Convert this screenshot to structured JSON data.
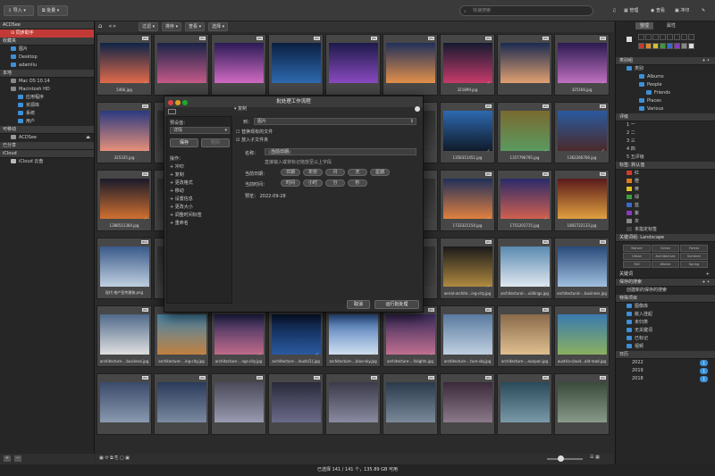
{
  "colors": {
    "accent": "#c23a36",
    "folder": "#3d8fd6"
  },
  "topbar": {
    "import": "导入",
    "batch": "批量",
    "search_placeholder": "快速搜索",
    "modes": [
      "管理",
      "查看",
      "冲印"
    ],
    "edit_icon": "✎"
  },
  "sidebar": {
    "sections": [
      {
        "header": "ACDSee",
        "items": [
          {
            "label": "同步助手",
            "selected": true
          }
        ]
      },
      {
        "header": "收藏夹",
        "items": [
          {
            "label": "图片"
          },
          {
            "label": "Desktop"
          },
          {
            "label": "adamliu"
          }
        ]
      },
      {
        "header": "本地",
        "items": [
          {
            "label": "Mac OS 10.14"
          },
          {
            "label": "Macintosh HD"
          },
          {
            "label": "应用程序"
          },
          {
            "label": "资源库"
          },
          {
            "label": "系统"
          },
          {
            "label": "用户"
          }
        ]
      },
      {
        "header": "可移动",
        "items": [
          {
            "label": "ACDSee"
          }
        ]
      },
      {
        "header": "已分享",
        "items": []
      },
      {
        "header": "iCloud",
        "items": [
          {
            "label": "iCloud 云盘"
          }
        ]
      }
    ]
  },
  "toolbar": {
    "filter": "过滤",
    "sort": "排序",
    "view": "查看",
    "select": "选择"
  },
  "grid": {
    "items": [
      {
        "name": "5466.jpg",
        "fmt": "JPG",
        "c": [
          "#0e2447",
          "#e26a4a"
        ]
      },
      {
        "name": "",
        "fmt": "JPG",
        "c": [
          "#1a2346",
          "#c55a8a"
        ]
      },
      {
        "name": "",
        "fmt": "JPG",
        "c": [
          "#2a1b55",
          "#d16ac4"
        ]
      },
      {
        "name": "",
        "fmt": "JPG",
        "c": [
          "#0a1f40",
          "#2f6ab0"
        ]
      },
      {
        "name": "",
        "fmt": "JPG",
        "c": [
          "#1d1a4a",
          "#8a4ac0"
        ]
      },
      {
        "name": "",
        "fmt": "JPG",
        "c": [
          "#20305a",
          "#e2904a"
        ]
      },
      {
        "name": "321899.jpg",
        "fmt": "JPG",
        "c": [
          "#141a30",
          "#c63a6a"
        ]
      },
      {
        "name": "",
        "fmt": "JPG",
        "c": [
          "#1a2a50",
          "#e0a070"
        ]
      },
      {
        "name": "325166.jpg",
        "fmt": "JPG",
        "c": [
          "#2a1a50",
          "#c070c0"
        ]
      },
      {
        "name": "325335.jpg",
        "fmt": "JPG",
        "c": [
          "#2a3a80",
          "#e6907a"
        ]
      },
      {
        "name": "",
        "fmt": "",
        "c": [
          "#333",
          "#444"
        ]
      },
      {
        "name": "",
        "fmt": "",
        "c": [
          "#333",
          "#444"
        ]
      },
      {
        "name": "",
        "fmt": "",
        "c": [
          "#333",
          "#444"
        ]
      },
      {
        "name": "",
        "fmt": "",
        "c": [
          "#333",
          "#444"
        ]
      },
      {
        "name": "",
        "fmt": "",
        "c": [
          "#333",
          "#444"
        ]
      },
      {
        "name": "1358311451.jpg",
        "fmt": "JPG",
        "c": [
          "#2d6ab0",
          "#101a2a"
        ]
      },
      {
        "name": "1357796795.jpg",
        "fmt": "JPG",
        "c": [
          "#7a6a30",
          "#5a9a60"
        ]
      },
      {
        "name": "1362266766.jpg",
        "fmt": "JPG",
        "c": [
          "#2a5aa0",
          "#4a2a2a"
        ]
      },
      {
        "name": "1388511364.jpg",
        "fmt": "JPG",
        "c": [
          "#1a1a2a",
          "#d07030"
        ]
      },
      {
        "name": "",
        "fmt": "",
        "c": [
          "#333",
          "#444"
        ]
      },
      {
        "name": "",
        "fmt": "",
        "c": [
          "#333",
          "#444"
        ]
      },
      {
        "name": "",
        "fmt": "",
        "c": [
          "#333",
          "#444"
        ]
      },
      {
        "name": "",
        "fmt": "",
        "c": [
          "#333",
          "#444"
        ]
      },
      {
        "name": "",
        "fmt": "",
        "c": [
          "#333",
          "#444"
        ]
      },
      {
        "name": "1733321154.jpg",
        "fmt": "JPG",
        "c": [
          "#20305a",
          "#e08040"
        ]
      },
      {
        "name": "1751201715.jpg",
        "fmt": "JPG",
        "c": [
          "#2a2a6a",
          "#d06050"
        ]
      },
      {
        "name": "1802722133.jpg",
        "fmt": "JPG",
        "c": [
          "#5a1a1a",
          "#e0a040"
        ]
      },
      {
        "name": "现代·地产宣传建筑.png",
        "fmt": "PNG",
        "c": [
          "#3a5a8a",
          "#c0d0e0"
        ]
      },
      {
        "name": "",
        "fmt": "",
        "c": [
          "#333",
          "#444"
        ]
      },
      {
        "name": "",
        "fmt": "",
        "c": [
          "#333",
          "#444"
        ]
      },
      {
        "name": "",
        "fmt": "",
        "c": [
          "#333",
          "#444"
        ]
      },
      {
        "name": "",
        "fmt": "",
        "c": [
          "#333",
          "#444"
        ]
      },
      {
        "name": "",
        "fmt": "",
        "c": [
          "#333",
          "#444"
        ]
      },
      {
        "name": "aerial-archite…ing-city.jpg",
        "fmt": "JPG",
        "c": [
          "#1a1a1a",
          "#b08a40"
        ]
      },
      {
        "name": "architectural-…uildings.jpg",
        "fmt": "JPG",
        "c": [
          "#5a8ab0",
          "#e0e8f0"
        ]
      },
      {
        "name": "architectural-…business.jpg",
        "fmt": "JPG",
        "c": [
          "#2a4a7a",
          "#a0c0e0"
        ]
      },
      {
        "name": "architecture-…business.jpg",
        "fmt": "JPG",
        "c": [
          "#506a8a",
          "#e0e0e0"
        ]
      },
      {
        "name": "architecture-…ing-city.jpg",
        "fmt": "JPG",
        "c": [
          "#4a8ab0",
          "#c08040"
        ]
      },
      {
        "name": "architecture-…ngs-city.jpg",
        "fmt": "JPG",
        "c": [
          "#2a2a5a",
          "#c06a8a"
        ]
      },
      {
        "name": "architecture-…louds(1).jpg",
        "fmt": "JPG",
        "c": [
          "#0a1a3a",
          "#2a5aa0"
        ]
      },
      {
        "name": "architecture-…blue-sky.jpg",
        "fmt": "JPG",
        "c": [
          "#3a6ab0",
          "#d0e0f0"
        ]
      },
      {
        "name": "architecture-…falights.jpg",
        "fmt": "JPG",
        "c": [
          "#3a2a5a",
          "#c07090"
        ]
      },
      {
        "name": "architecture-…ture-sky.jpg",
        "fmt": "JPG",
        "c": [
          "#5a7aa0",
          "#c0d0e0"
        ]
      },
      {
        "name": "architecture-…eunpan.jpg",
        "fmt": "JPG",
        "c": [
          "#8a6a4a",
          "#e0c090"
        ]
      },
      {
        "name": "austria-cloud…ald-road.jpg",
        "fmt": "JPG",
        "c": [
          "#3a7ab0",
          "#8ab060"
        ]
      },
      {
        "name": "",
        "fmt": "JPG",
        "c": [
          "#3a4a6a",
          "#8a9ab0"
        ]
      },
      {
        "name": "",
        "fmt": "JPG",
        "c": [
          "#2a3a5a",
          "#7a8aa0"
        ]
      },
      {
        "name": "",
        "fmt": "JPG",
        "c": [
          "#4a4a5a",
          "#9a9ab0"
        ]
      },
      {
        "name": "",
        "fmt": "JPG",
        "c": [
          "#2a2a3a",
          "#6a6a8a"
        ]
      },
      {
        "name": "",
        "fmt": "JPG",
        "c": [
          "#3a3a4a",
          "#8a8aa0"
        ]
      },
      {
        "name": "",
        "fmt": "JPG",
        "c": [
          "#2a3a4a",
          "#7a8a9a"
        ]
      },
      {
        "name": "",
        "fmt": "JPG",
        "c": [
          "#3a2a3a",
          "#8a7a8a"
        ]
      },
      {
        "name": "",
        "fmt": "JPG",
        "c": [
          "#2a4a5a",
          "#7a9aaa"
        ]
      },
      {
        "name": "",
        "fmt": "JPG",
        "c": [
          "#3a4a3a",
          "#8a9a8a"
        ]
      }
    ]
  },
  "status": "已选择 141 / 141 个，135.89 GB 可用",
  "right": {
    "tabs": [
      "整理",
      "属性"
    ],
    "categories_header": "类别组",
    "categories": [
      "类别",
      "Albums",
      "People",
      "Friends",
      "Places",
      "Various"
    ],
    "rating_header": "评级",
    "ratings": [
      "一",
      "二",
      "三",
      "四",
      "五评级"
    ],
    "labels_header": "标签: 默认值",
    "labels": [
      {
        "t": "红",
        "c": "#d23a2a"
      },
      {
        "t": "橙",
        "c": "#e07a20"
      },
      {
        "t": "黄",
        "c": "#e0c020"
      },
      {
        "t": "绿",
        "c": "#3aa03a"
      },
      {
        "t": "蓝",
        "c": "#3a6ad0"
      },
      {
        "t": "紫",
        "c": "#8a3ac0"
      },
      {
        "t": "灰",
        "c": "#888888"
      },
      {
        "t": "未指定标签",
        "c": "#444444"
      }
    ],
    "keywords_header": "关键词组: Landscape",
    "keywords": [
      "Nature",
      "Ocean",
      "Forest",
      "Urban",
      "Architecture",
      "Summer",
      "Fall",
      "Winter",
      "Spring"
    ],
    "keyword_label": "关键词",
    "saved_header": "保存的搜索",
    "saved_item": "创建新的保存的搜索",
    "special_header": "特殊项目",
    "special": [
      "图像库",
      "嵌入挂起",
      "未归类",
      "无关键词",
      "已标记",
      "视频"
    ],
    "calendar_header": "日历",
    "years": [
      "2022",
      "2019",
      "2018"
    ]
  },
  "modal": {
    "title": "批处理工作流程",
    "preset_label": "预设值：",
    "preset_value": "详情",
    "save": "保存",
    "delete": "删除",
    "ops_label": "操作：",
    "ops": [
      "冲印",
      "复制",
      "更改格式",
      "移动",
      "设置信息",
      "更改大小",
      "调整时间标签",
      "重命名"
    ],
    "section1": "复制",
    "to_label": "到：",
    "to_value": "图片",
    "opt1": "替换现有的文件",
    "opt2": "放入子文件夹",
    "name_label": "名称：",
    "name_token": "当前日期",
    "hint": "直接输入或将标记拖放至以上字段",
    "date_label": "当前日期：",
    "date_tokens": [
      "日期",
      "年份",
      "月",
      "天",
      "星期"
    ],
    "time_label": "当前时间：",
    "time_tokens": [
      "时间",
      "小时",
      "分",
      "秒"
    ],
    "preview_label": "预览：",
    "preview_value": "2022-09-28",
    "cancel": "取消",
    "run": "运行批处理"
  }
}
